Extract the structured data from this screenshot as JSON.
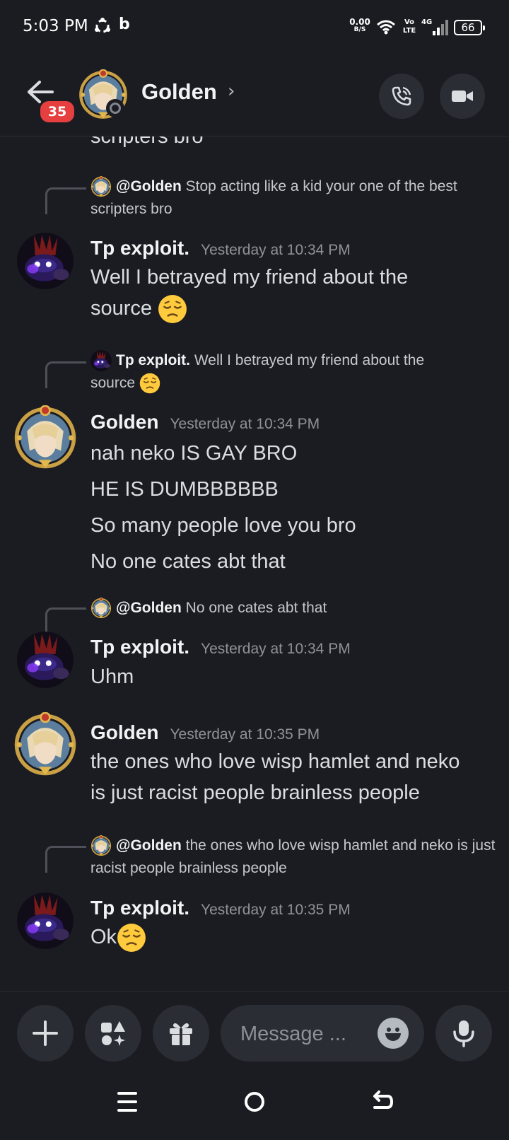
{
  "status_bar": {
    "time": "5:03 PM",
    "net_speed": "0.00",
    "net_unit": "B/S",
    "volte_top": "Vo",
    "volte_bottom": "LTE",
    "network": "4G",
    "battery": "66"
  },
  "header": {
    "title": "Golden",
    "unread_count": "35",
    "chevron": "›"
  },
  "messages": {
    "cut_off_text": "scripters bro",
    "m1": {
      "reply_name": "@Golden",
      "reply_text": "Stop acting like a kid your one of the best scripters bro",
      "author": "Tp exploit.",
      "time": "Yesterday at 10:34 PM",
      "line1": "Well I betrayed my friend about the",
      "line2": "source"
    },
    "m2": {
      "reply_name": "Tp exploit.",
      "reply_text": "Well I betrayed my friend about the",
      "reply_text2": "source",
      "author": "Golden",
      "time": "Yesterday at 10:34 PM",
      "lines": [
        "nah neko IS GAY BRO",
        "HE IS DUMBBBBBB",
        "So many people love you bro",
        "No one cates abt that"
      ]
    },
    "m3": {
      "reply_name": "@Golden",
      "reply_text": "No one cates abt that",
      "author": "Tp exploit.",
      "time": "Yesterday at 10:34 PM",
      "text": "Uhm"
    },
    "m4": {
      "author": "Golden",
      "time": "Yesterday at 10:35 PM",
      "line1": "the ones who love wisp hamlet and neko",
      "line2": "is just racist people brainless people"
    },
    "m5": {
      "reply_name": "@Golden",
      "reply_text": "the ones who love wisp hamlet and neko is just racist people brainless people",
      "author": "Tp exploit.",
      "time": "Yesterday at 10:35 PM",
      "text": "Ok"
    }
  },
  "composer": {
    "placeholder": "Message ..."
  },
  "icons": {
    "back": "arrow-left-icon",
    "call": "phone-icon",
    "video": "video-camera-icon",
    "plus": "plus-icon",
    "apps": "apps-icon",
    "gift": "gift-icon",
    "emoji": "emoji-icon",
    "mic": "microphone-icon"
  },
  "colors": {
    "background": "#1b1c22",
    "badge": "#e5403f",
    "button_bg": "#2b2d35"
  }
}
